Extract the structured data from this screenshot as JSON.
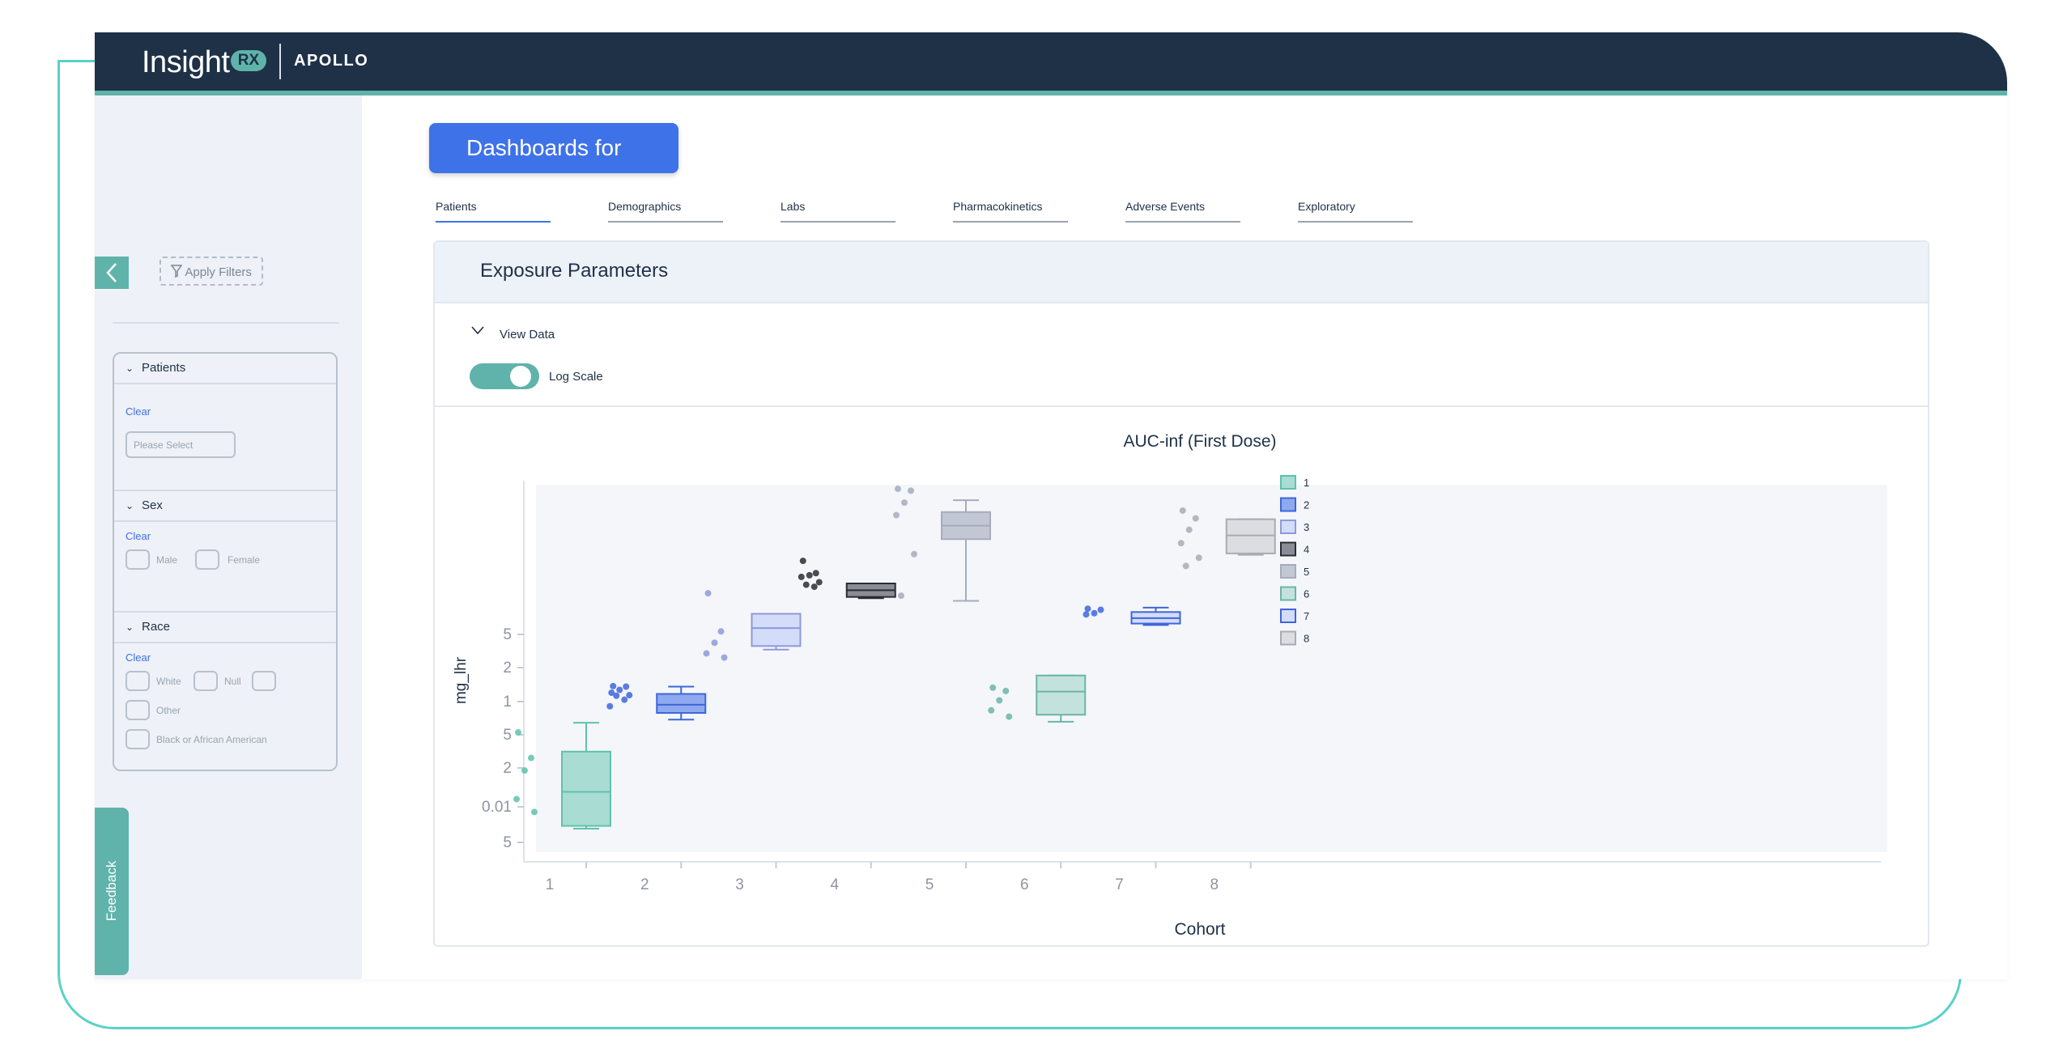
{
  "header": {
    "logo_text": "Insight",
    "logo_badge": "RX",
    "product": "APOLLO"
  },
  "sidebar": {
    "apply_filters": "Apply Filters",
    "sections": [
      {
        "title": "Patients",
        "clear": "Clear",
        "placeholder": "Please Select"
      },
      {
        "title": "Sex",
        "clear": "Clear",
        "options": [
          "Male",
          "Female"
        ]
      },
      {
        "title": "Race",
        "clear": "Clear",
        "options": [
          "White",
          "Null",
          "Other",
          "Black or African American"
        ]
      }
    ],
    "feedback": "Feedback"
  },
  "main": {
    "dashboard_button": "Dashboards for",
    "tabs": [
      "Patients",
      "Demographics",
      "Labs",
      "Pharmacokinetics",
      "Adverse Events",
      "Exploratory"
    ],
    "active_tab": "Patients",
    "panel_title": "Exposure Parameters",
    "view_data": "View Data",
    "log_scale_label": "Log Scale",
    "log_scale_on": true
  },
  "colors": {
    "topbar": "#1f3147",
    "accent_teal": "#5fb3aa",
    "primary_blue": "#3e72e8",
    "sidebar_bg": "#eef1f7"
  },
  "chart_data": {
    "type": "box",
    "title": "AUC-inf (First Dose)",
    "xlabel": "Cohort",
    "ylabel": "mg_lhr",
    "log_scale": true,
    "y_ticks": [
      "5",
      "0.01",
      "2",
      "5",
      "1",
      "2",
      "5"
    ],
    "categories": [
      "1",
      "2",
      "3",
      "4",
      "5",
      "6",
      "7",
      "8"
    ],
    "legend": [
      "1",
      "2",
      "3",
      "4",
      "5",
      "6",
      "7",
      "8"
    ],
    "series": [
      {
        "name": "1",
        "color": "#5ec2ac",
        "fill": "#a9dcd2",
        "min": 0.0052,
        "q1": 0.0055,
        "median": 0.011,
        "q3": 0.025,
        "max": 0.045,
        "points": [
          0.037,
          0.022,
          0.017,
          0.0095,
          0.0073
        ]
      },
      {
        "name": "2",
        "color": "#3e66da",
        "fill": "#8ea9ee",
        "min": 0.048,
        "q1": 0.055,
        "median": 0.065,
        "q3": 0.081,
        "max": 0.094,
        "points": [
          0.095,
          0.094,
          0.088,
          0.083,
          0.079,
          0.078,
          0.072,
          0.063
        ]
      },
      {
        "name": "3",
        "color": "#8e9ad8",
        "fill": "#d3dcf8",
        "min": 0.2,
        "q1": 0.215,
        "median": 0.31,
        "q3": 0.415,
        "max": 0.415,
        "points": [
          0.63,
          0.29,
          0.23,
          0.185,
          0.17
        ]
      },
      {
        "name": "4",
        "color": "#2b2d34",
        "fill": "#8a8d95",
        "min": 0.57,
        "q1": 0.585,
        "median": 0.67,
        "q3": 0.77,
        "max": 0.77,
        "points": [
          1.22,
          0.95,
          0.91,
          0.88,
          0.79,
          0.75,
          0.72
        ]
      },
      {
        "name": "5",
        "color": "#a6acbd",
        "fill": "#c2c7d3",
        "min": 0.54,
        "q1": 1.9,
        "median": 2.5,
        "q3": 3.3,
        "max": 4.2,
        "points": [
          5.3,
          5.1,
          4.0,
          3.1,
          1.4,
          0.6
        ]
      },
      {
        "name": "6",
        "color": "#6bb5a7",
        "fill": "#c4e2dc",
        "min": 0.046,
        "q1": 0.053,
        "median": 0.085,
        "q3": 0.118,
        "max": 0.118,
        "points": [
          0.092,
          0.086,
          0.071,
          0.058,
          0.051
        ]
      },
      {
        "name": "7",
        "color": "#3e66da",
        "fill": "#d3dcf8",
        "min": 0.33,
        "q1": 0.34,
        "median": 0.38,
        "q3": 0.43,
        "max": 0.47,
        "points": [
          0.46,
          0.45,
          0.42,
          0.41
        ]
      },
      {
        "name": "8",
        "color": "#a7abb4",
        "fill": "#dcdde1",
        "min": 1.38,
        "q1": 1.42,
        "median": 2.05,
        "q3": 2.85,
        "max": 2.85,
        "points": [
          3.4,
          2.9,
          2.3,
          1.75,
          1.3,
          1.1
        ]
      }
    ]
  }
}
